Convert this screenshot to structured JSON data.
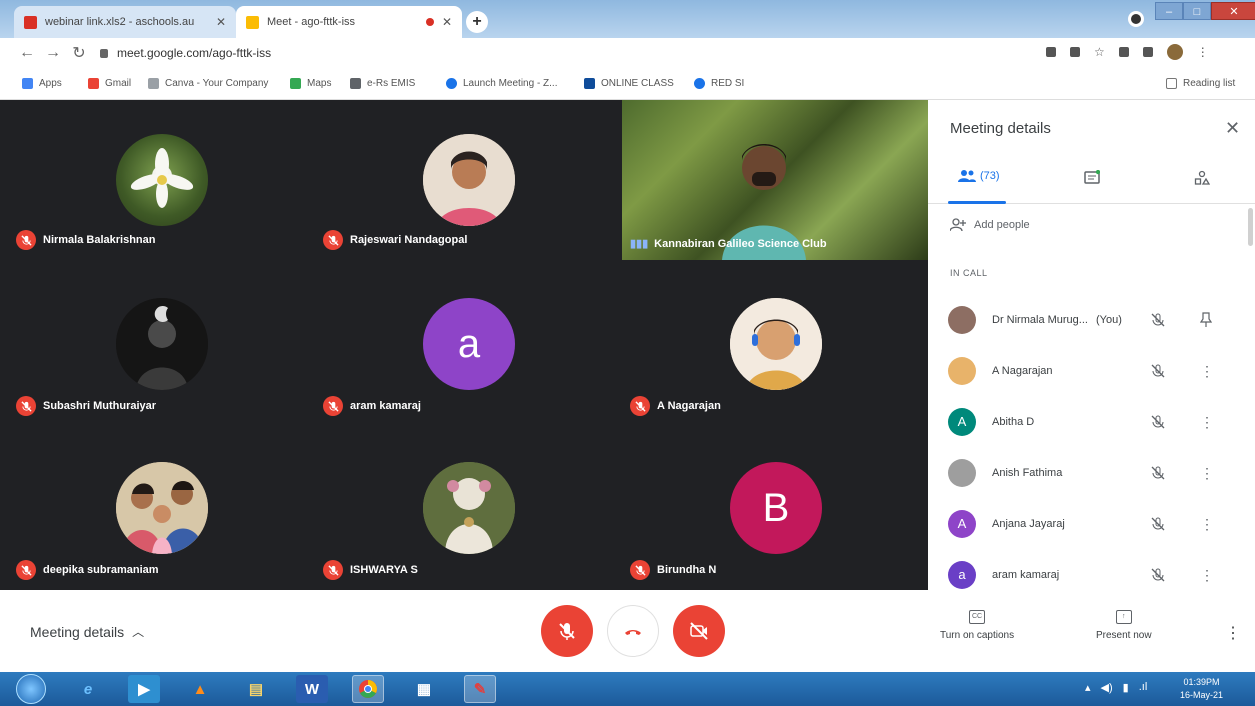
{
  "browser": {
    "tabs": [
      {
        "title": "webinar link.xls2 - aschools.au",
        "favicon_color": "#d93025"
      },
      {
        "title": "Meet - ago-fttk-iss",
        "favicon_color": "#fbbc04"
      }
    ],
    "new_tab": "+",
    "url": "meet.google.com/ago-fttk-iss",
    "bookmarks": [
      {
        "label": "Apps",
        "color": "#4285f4"
      },
      {
        "label": "Gmail",
        "color": "#ea4335"
      },
      {
        "label": "Canva - Your Company",
        "color": "#9aa0a6"
      },
      {
        "label": "Maps",
        "color": "#34a853"
      },
      {
        "label": "e-Rs EMIS",
        "color": "#5f6368"
      },
      {
        "label": "Launch Meeting - Z...",
        "color": "#1a73e8"
      },
      {
        "label": "ONLINE CLASS",
        "color": "#0f4c9a"
      },
      {
        "label": "RED SI",
        "color": "#1a73e8"
      }
    ],
    "reading_list": "Reading list"
  },
  "tiles": [
    {
      "name": "Nirmala Balakrishnan",
      "kind": "photo",
      "photo": "flower"
    },
    {
      "name": "Rajeswari Nandagopal",
      "kind": "photo",
      "photo": "woman"
    },
    {
      "name": "Kannabiran Galileo Science Club",
      "kind": "video"
    },
    {
      "name": "Subashri Muthuraiyar",
      "kind": "photo",
      "photo": "statue"
    },
    {
      "name": "aram kamaraj",
      "kind": "letter",
      "letter": "a",
      "color": "#8e44c8"
    },
    {
      "name": "A Nagarajan",
      "kind": "photo",
      "photo": "child"
    },
    {
      "name": "deepika subramaniam",
      "kind": "photo",
      "photo": "family"
    },
    {
      "name": "ISHWARYA S",
      "kind": "photo",
      "photo": "idol"
    },
    {
      "name": "Birundha N",
      "kind": "letter",
      "letter": "B",
      "color": "#c2185b"
    }
  ],
  "panel": {
    "title": "Meeting details",
    "people_tab_count": "(73)",
    "add_people": "Add people",
    "in_call": "IN CALL",
    "participants": [
      {
        "name": "Dr Nirmala Murug...",
        "you": "(You)",
        "avatar": "photo",
        "color": "#8d6e63",
        "action": "pin"
      },
      {
        "name": "A Nagarajan",
        "avatar": "photo",
        "color": "#e8b36a",
        "action": "more"
      },
      {
        "name": "Abitha D",
        "avatar": "letter",
        "letter": "A",
        "color": "#00897b",
        "action": "more"
      },
      {
        "name": "Anish Fathima",
        "avatar": "photo",
        "color": "#9e9e9e",
        "action": "more"
      },
      {
        "name": "Anjana Jayaraj",
        "avatar": "letter",
        "letter": "A",
        "color": "#8e44c8",
        "action": "more"
      },
      {
        "name": "aram kamaraj",
        "avatar": "letter",
        "letter": "a",
        "color": "#6a3fc6",
        "action": "more"
      }
    ]
  },
  "bottom": {
    "meeting_details": "Meeting details",
    "captions": "Turn on captions",
    "present": "Present now"
  },
  "taskbar": {
    "time": "01:39PM",
    "date": "16-May-21"
  },
  "colors": {
    "mic_off_red": "#ea4335",
    "panel_accent": "#1a73e8",
    "grid_bg": "#202124"
  }
}
